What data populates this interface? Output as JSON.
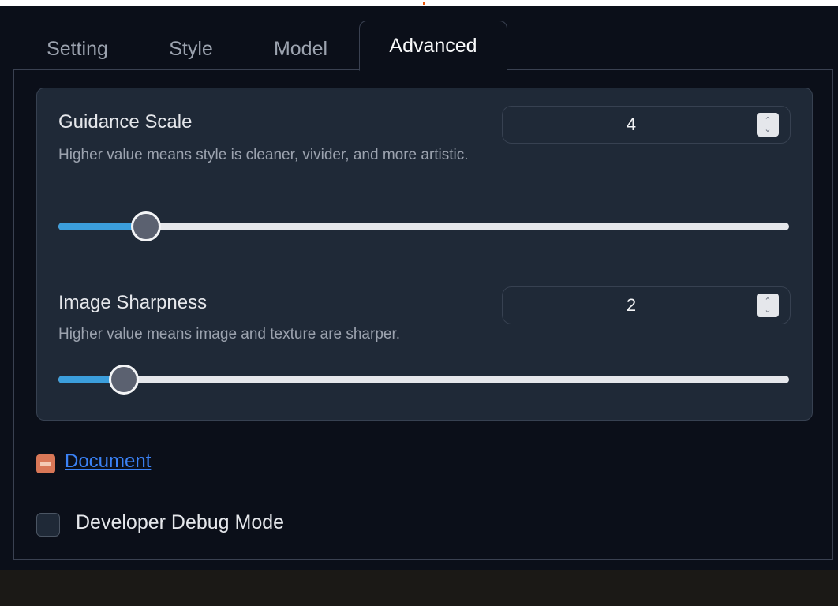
{
  "tabs": [
    {
      "label": "Setting",
      "active": false
    },
    {
      "label": "Style",
      "active": false
    },
    {
      "label": "Model",
      "active": false
    },
    {
      "label": "Advanced",
      "active": true
    }
  ],
  "guidance": {
    "label": "Guidance Scale",
    "description": "Higher value means style is cleaner, vivider, and more artistic.",
    "value": "4",
    "slider_fraction": 0.12
  },
  "sharpness": {
    "label": "Image Sharpness",
    "description": "Higher value means image and texture are sharper.",
    "value": "2",
    "slider_fraction": 0.09
  },
  "document_link": {
    "label": "Document",
    "icon": "document-icon"
  },
  "debug": {
    "label": "Developer Debug Mode",
    "checked": false
  },
  "colors": {
    "accent": "#3b9edc",
    "link": "#3b82f6",
    "background": "#0b0f19",
    "card": "#1f2937"
  }
}
